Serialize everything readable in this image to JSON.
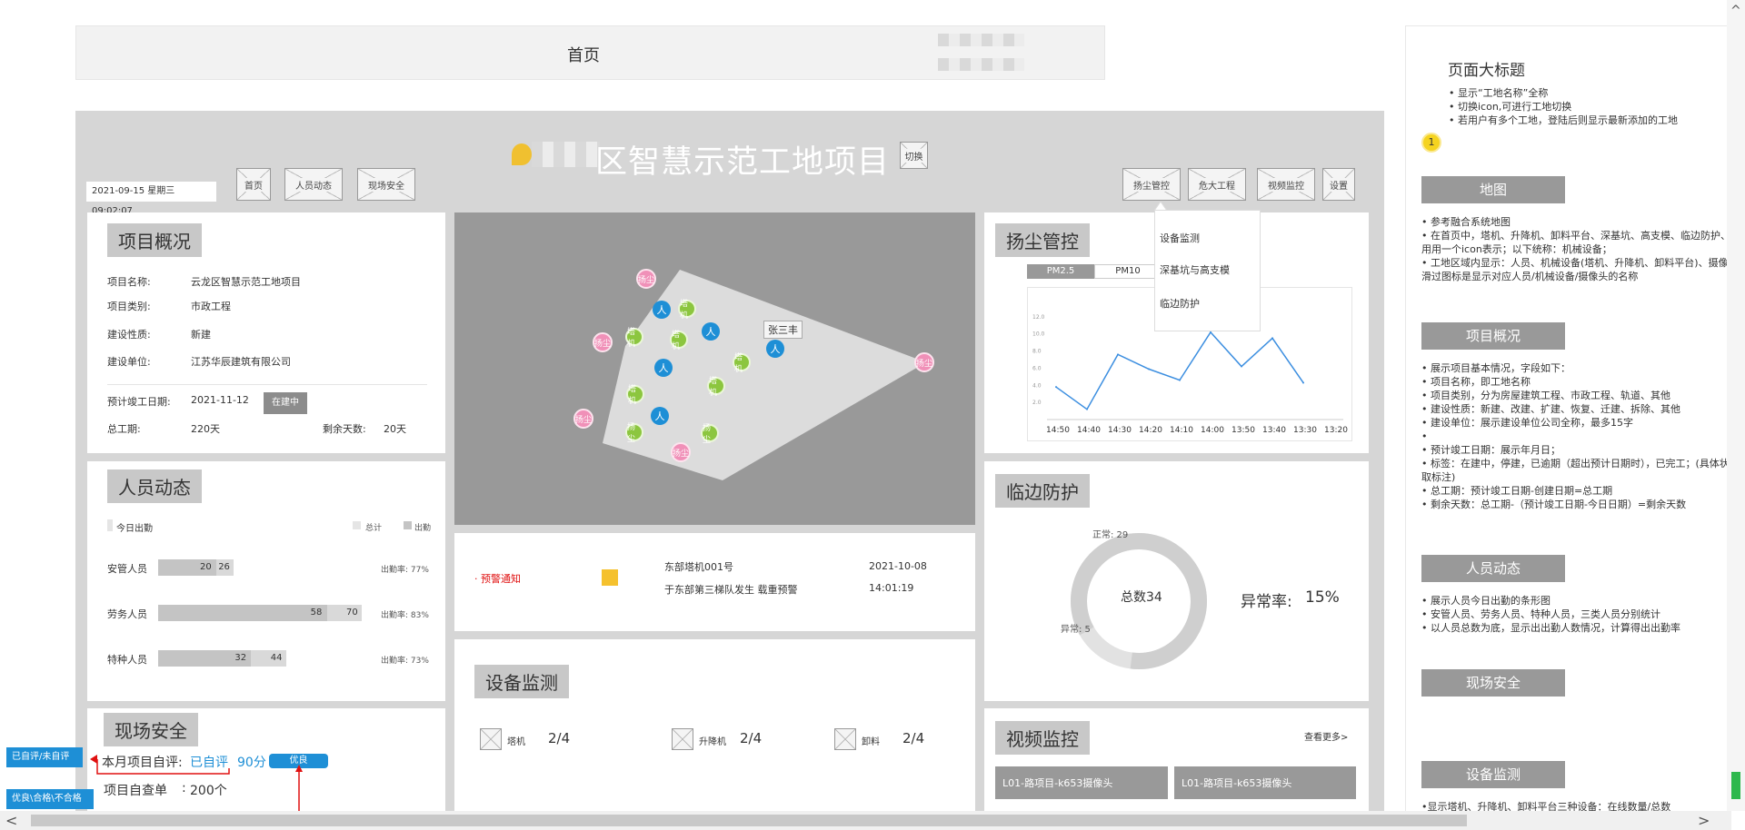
{
  "page_header": {
    "title": "首页"
  },
  "project": {
    "title": "区智慧示范工地项目",
    "switch_label": "切换",
    "datetime": "2021-09-15 星期三 09:02:07"
  },
  "nav_left": [
    "首页",
    "人员动态",
    "现场安全"
  ],
  "nav_right": [
    "扬尘管控",
    "危大工程",
    "视频监控",
    "设置"
  ],
  "dropdown": [
    "设备监测",
    "深基坑与高支模",
    "临边防护"
  ],
  "overview": {
    "title": "项目概况",
    "fields": [
      [
        "项目名称:",
        "云龙区智慧示范工地项目"
      ],
      [
        "项目类别:",
        "市政工程"
      ],
      [
        "建设性质:",
        "新建"
      ],
      [
        "建设单位:",
        "江苏华辰建筑有限公司"
      ]
    ],
    "finish_label": "预计竣工日期:",
    "finish_date": "2021-11-12",
    "status": "在建中",
    "total_label": "总工期:",
    "total": "220天",
    "remain_label": "剩余天数:",
    "remain": "20天"
  },
  "personnel": {
    "title": "人员动态",
    "legend_today": "今日出勤",
    "legend_total": "总计",
    "legend_out": "出勤",
    "rows": [
      {
        "name": "安管人员",
        "a": "20",
        "b": "26",
        "rate": "出勤率: 77%",
        "av": 20,
        "bv": 26
      },
      {
        "name": "劳务人员",
        "a": "58",
        "b": "70",
        "rate": "出勤率: 83%",
        "av": 58,
        "bv": 70
      },
      {
        "name": "特种人员",
        "a": "32",
        "b": "44",
        "rate": "出勤率: 73%",
        "av": 32,
        "bv": 44
      }
    ]
  },
  "safety": {
    "title": "现场安全",
    "self_label": "本月项目自评:",
    "self_status": "已自评",
    "score": "90分",
    "grade": "优良",
    "check_label": "项目自查单",
    "check_sep": ":",
    "check_value": "200个"
  },
  "side_tags": [
    "已自评/未自评",
    "优良\\合格\\不合格"
  ],
  "map": {
    "tooltip": "张三丰",
    "marker_people": "人",
    "marker_tower": "塔机",
    "marker_dust": "扬尘"
  },
  "alert": {
    "label": "· 预警通知",
    "line1": "东部塔机001号",
    "line2": "于东部第三梯队发生 载重预警",
    "date": "2021-10-08",
    "time": "14:01:19"
  },
  "equipment": {
    "title": "设备监测",
    "items": [
      {
        "name": "塔机",
        "val": "2/4"
      },
      {
        "name": "升降机",
        "val": "2/4"
      },
      {
        "name": "卸料",
        "val": "2/4"
      }
    ]
  },
  "dust": {
    "title": "扬尘管控",
    "tabs": [
      "PM2.5",
      "PM10"
    ]
  },
  "chart_data": {
    "type": "line",
    "x": [
      "14:50",
      "14:40",
      "14:30",
      "14:20",
      "14:10",
      "14:00",
      "13:50",
      "13:40",
      "13:30",
      "13:20"
    ],
    "series": [
      {
        "values": [
          3.8,
          1.2,
          7.6,
          5.9,
          4.6,
          10.2,
          6.2,
          9.5,
          4.3
        ]
      }
    ],
    "y_ticks": [
      "2.0",
      "4.0",
      "6.0",
      "8.0",
      "10.0",
      "12.0"
    ],
    "ylim": [
      0,
      14
    ]
  },
  "edge": {
    "title": "临边防护",
    "normal": "正常: 29",
    "abnormal": "异常: 5",
    "total": "总数34",
    "rate_label": "异常率:",
    "rate": "15%",
    "normal_v": 29,
    "abnormal_v": 5
  },
  "video": {
    "title": "视频监控",
    "more": "查看更多>",
    "cams": [
      "L01-路项目-k653摄像头",
      "L01-路项目-k653摄像头"
    ]
  },
  "notes": {
    "heading": "页面大标题",
    "heading_items": [
      "• 显示“工地名称”全称",
      "• 切换icon,可进行工地切换",
      "• 若用户有多个工地，登陆后则显示最新添加的工地"
    ],
    "badge": "1",
    "sections": [
      {
        "label": "地图",
        "items": [
          "• 参考融合系统地图",
          "• 在首页中，塔机、升降机、卸料平台、深基坑、高支模、临边防护、扬",
          "用用一个icon表示；以下统称：机械设备；",
          "• 工地区域内显示：人员、机械设备(塔机、升降机、卸料平台)、摄像头的",
          "滑过图标是显示对应人员/机械设备/摄像头的名称"
        ]
      },
      {
        "label": "项目概况",
        "items": [
          "• 展示项目基本情况，字段如下：",
          "• 项目名称，即工地名称",
          "• 项目类别，分为房屋建筑工程、市政工程、轨道、其他",
          "• 建设性质：新建、改建、扩建、恢复、迁建、拆除、其他",
          "• 建设单位：展示建设单位公司全称，最多15字",
          "•",
          "• 预计竣工日期：展示年月日；",
          "• 标签：在建中，停建，已逾期（超出预计日期时），已完工；(具体状态",
          "取标注)",
          "• 总工期：预计竣工日期-创建日期=总工期",
          "• 剩余天数：总工期-（预计竣工日期-今日日期）=剩余天数"
        ]
      },
      {
        "label": "人员动态",
        "items": [
          "• 展示人员今日出勤的条形图",
          "• 安管人员、劳务人员、特种人员，三类人员分别统计",
          "• 以人员总数为底，显示出出勤人数情况，计算得出出勤率"
        ]
      },
      {
        "label": "现场安全",
        "items": []
      },
      {
        "label": "设备监测",
        "items": [
          "•显示塔机、升降机、卸料平台三种设备：在线数量/总数"
        ]
      }
    ]
  }
}
